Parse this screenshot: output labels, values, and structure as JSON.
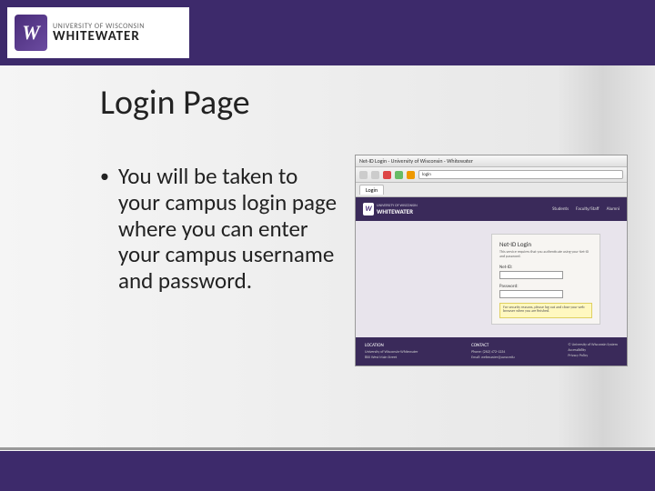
{
  "logo": {
    "mark_letter": "W",
    "line1": "UNIVERSITY OF WISCONSIN",
    "line2": "WHITEWATER"
  },
  "slide": {
    "title": "Login Page",
    "bullet": "You will be taken to your campus login page where you can enter your campus username and password."
  },
  "browser": {
    "window_title": "Net-ID Login - University of Wisconsin - Whitewater",
    "address": "login",
    "tab": "Login"
  },
  "loginpage": {
    "logo_line1": "UNIVERSITY OF WISCONSIN",
    "logo_line2": "WHITEWATER",
    "nav": [
      "Students",
      "Faculty/Staff",
      "Alumni"
    ],
    "card_title": "Net-ID Login",
    "card_desc": "This service requires that you authenticate using your Net-ID and password.",
    "label_user": "Net-ID:",
    "label_pass": "Password:",
    "note": "For security reasons, please log out and close your web browser when you are finished."
  },
  "footer": {
    "col1_h": "LOCATION",
    "col1_a": "University of Wisconsin-Whitewater",
    "col1_b": "800 West Main Street",
    "col2_h": "CONTACT",
    "col2_a": "Phone: (262) 472-1234",
    "col2_b": "Email: webmaster@uww.edu",
    "col3_a": "© University of Wisconsin System",
    "col3_b": "Accessibility",
    "col3_c": "Privacy Policy"
  }
}
